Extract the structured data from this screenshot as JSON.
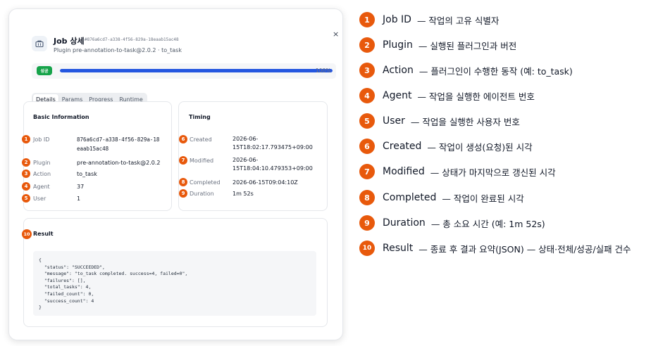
{
  "job_card": {
    "title": "Job 상세",
    "job_id": "#876a6cd7-a338-4f56-829a-18eaab15ac48",
    "subtitle": "Plugin pre-annotation-to-task@2.0.2 · to_task",
    "close_label": "×",
    "status_badge": "성공",
    "progress_fraction": 1.0,
    "progress_text": "100%",
    "tabs": [
      "Details",
      "Params",
      "Progress",
      "Runtime"
    ],
    "active_tab": "Details",
    "basic": {
      "title": "Basic Information",
      "job_id_label": "Job ID",
      "job_id_value_line1": "876a6cd7-a338-4f56-829a-18",
      "job_id_value_line2": "eaab15ac48",
      "plugin_label": "Plugin",
      "plugin_value": "pre-annotation-to-task@2.0.2",
      "action_label": "Action",
      "action_value": "to_task",
      "agent_label": "Agent",
      "agent_value": "37",
      "user_label": "User",
      "user_value": "1"
    },
    "timing": {
      "title": "Timing",
      "created_label": "Created",
      "created_value": "2026-06-15T18:02:17.793475+09:00",
      "modified_label": "Modified",
      "modified_value": "2026-06-15T18:04:10.479353+09:00",
      "completed_label": "Completed",
      "completed_value": "2026-06-15T09:04:10Z",
      "duration_label": "Duration",
      "duration_value": "1m 52s"
    },
    "result": {
      "title": "Result",
      "json_lines": [
        "{",
        "  \"status\": \"SUCCEEDED\",",
        "  \"message\": \"to_task completed. success=4, failed=0\",",
        "  \"failures\": [],",
        "  \"total_tasks\": 4,",
        "  \"failed_count\": 0,",
        "  \"success_count\": 4",
        "}"
      ]
    },
    "markers": [
      "1",
      "2",
      "3",
      "4",
      "5",
      "6",
      "7",
      "8",
      "9",
      "10"
    ]
  },
  "legend": [
    {
      "num": "1",
      "name": "Job ID",
      "desc": "—  작업의 고유 식별자"
    },
    {
      "num": "2",
      "name": "Plugin",
      "desc": "—  실행된 플러그인과 버전"
    },
    {
      "num": "3",
      "name": "Action",
      "desc": "—  플러그인이 수행한 동작 (예: to_task)"
    },
    {
      "num": "4",
      "name": "Agent",
      "desc": "—  작업을 실행한 에이전트 번호"
    },
    {
      "num": "5",
      "name": "User",
      "desc": "—  작업을 실행한 사용자 번호"
    },
    {
      "num": "6",
      "name": "Created",
      "desc": "—  작업이 생성(요청)된 시각"
    },
    {
      "num": "7",
      "name": "Modified",
      "desc": "—  상태가 마지막으로 갱신된 시각"
    },
    {
      "num": "8",
      "name": "Completed",
      "desc": "—  작업이 완료된 시각"
    },
    {
      "num": "9",
      "name": "Duration",
      "desc": "—  총 소요 시간 (예: 1m 52s)"
    },
    {
      "num": "10",
      "name": "Result",
      "desc": "—  종료 후 결과 요약(JSON) — 상태·전체/성공/실패 건수"
    }
  ],
  "colors": {
    "marker": "#e8590c",
    "success_badge": "#16a34a",
    "progress_fill": "#2456e0"
  },
  "icons": {
    "header": "briefcase-icon",
    "close": "close-icon"
  }
}
